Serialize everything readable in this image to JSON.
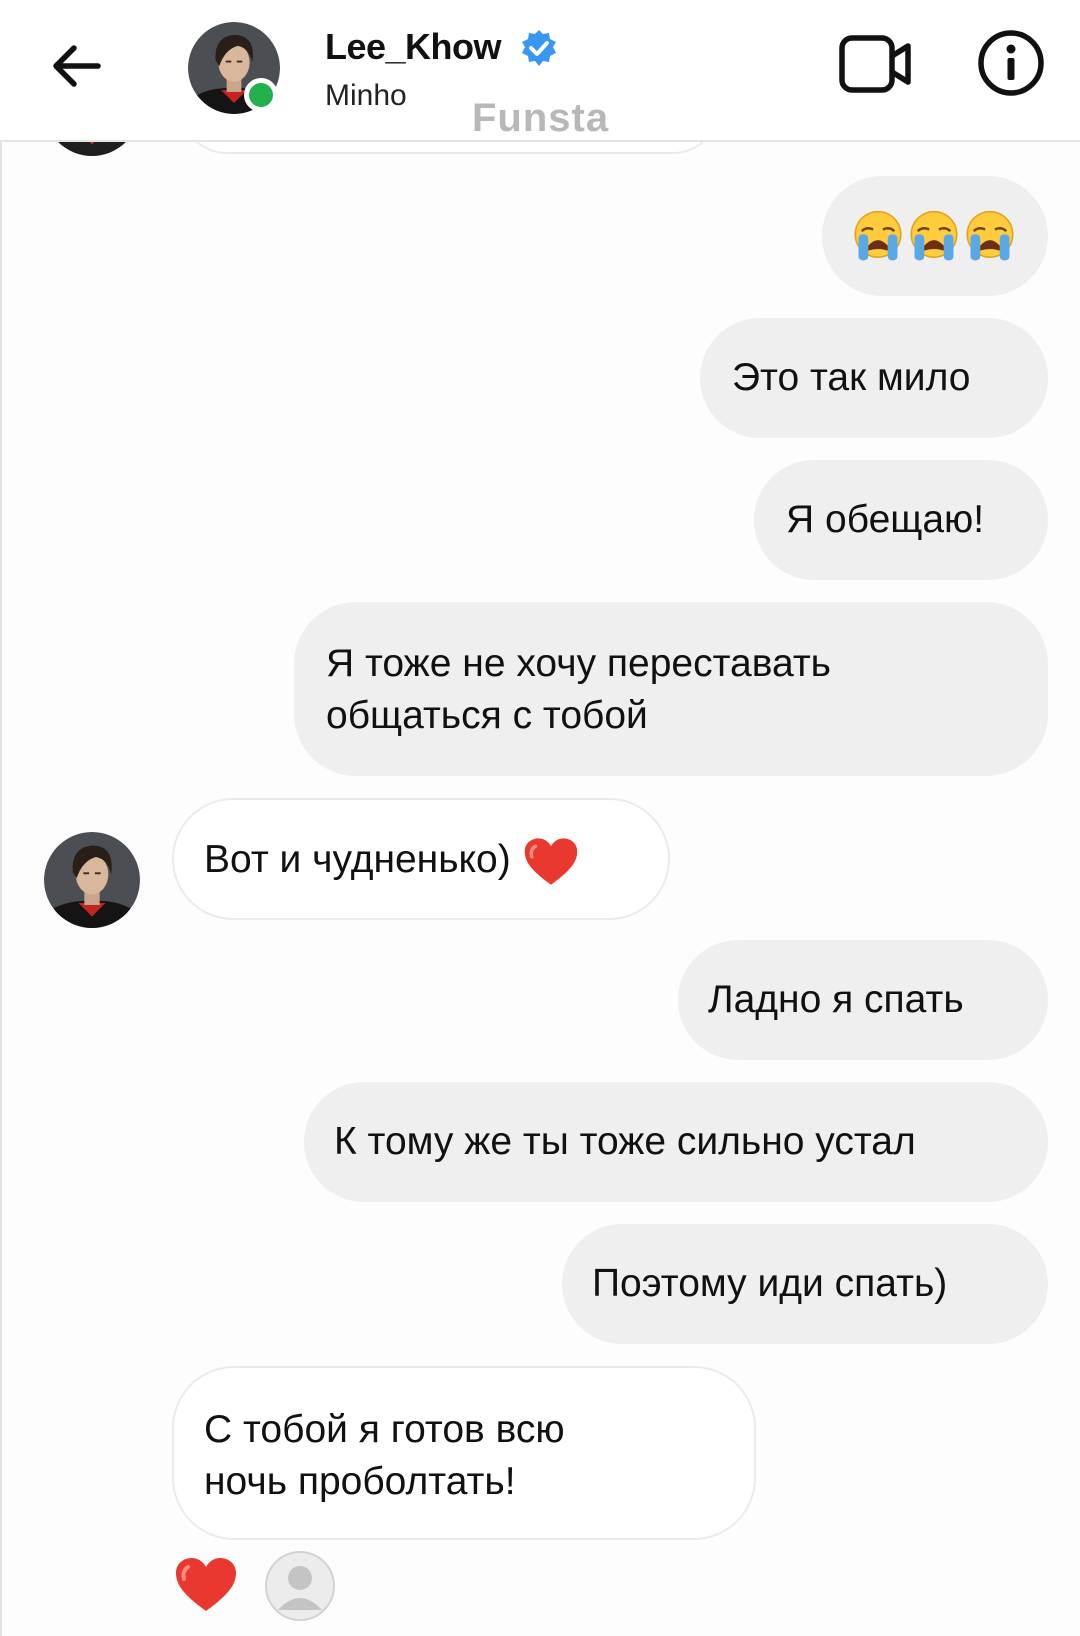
{
  "header": {
    "username": "Lee_Khow",
    "subtitle": "Minho",
    "watermark": "Funsta",
    "status": "online"
  },
  "icons": {
    "back": "arrow-left-icon",
    "verified": "verified-badge-icon",
    "video": "video-camera-icon",
    "info": "info-icon",
    "crying": "loudly-crying-face-icon",
    "heart": "red-heart-icon",
    "seen": "default-avatar-icon"
  },
  "colors": {
    "online": "#22b14c",
    "verified": "#3897f0",
    "heart": "#e8382f",
    "outgoing_bubble": "#efeff0",
    "incoming_bubble": "#ffffff"
  },
  "messages": [
    {
      "side": "out",
      "text": "😭😭😭"
    },
    {
      "side": "out",
      "text": "Это так мило"
    },
    {
      "side": "out",
      "text": "Я обещаю!"
    },
    {
      "side": "out",
      "lines": [
        "Я тоже не хочу переставать",
        "общаться с тобой"
      ]
    },
    {
      "side": "in",
      "text": "Вот и чудненько)",
      "emoji": "❤️"
    },
    {
      "side": "out",
      "text": "Ладно я спать"
    },
    {
      "side": "out",
      "text": "К тому же ты тоже сильно устал"
    },
    {
      "side": "out",
      "text": "Поэтому иди спать)"
    },
    {
      "side": "in",
      "lines": [
        "С тобой я готов всю",
        "ночь проболтать!"
      ]
    }
  ],
  "reaction": {
    "emoji": "❤️"
  }
}
